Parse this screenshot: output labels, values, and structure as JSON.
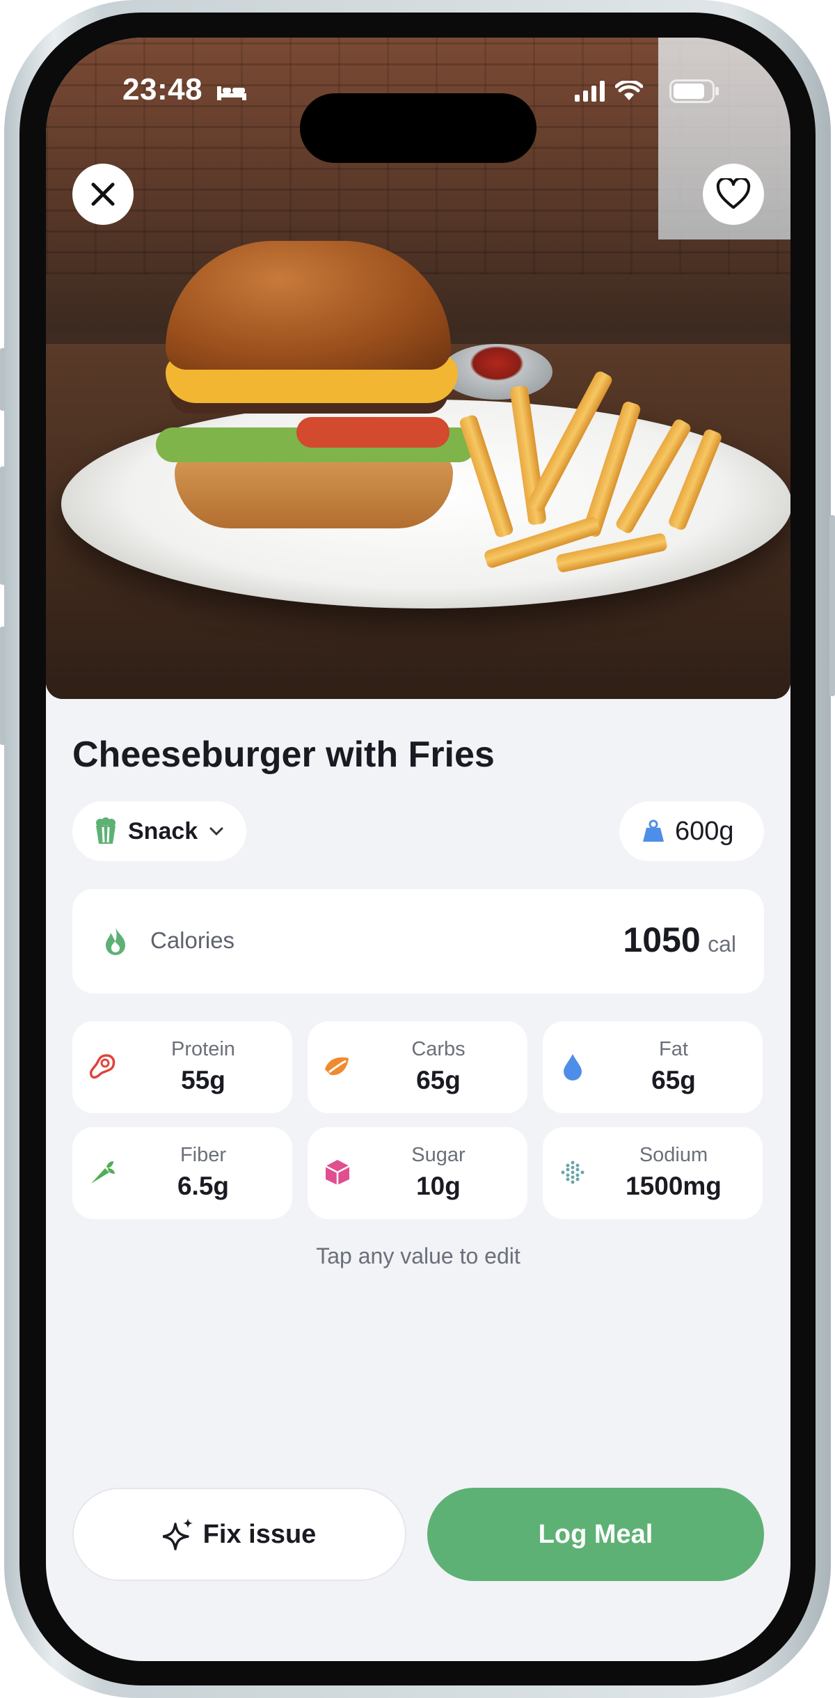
{
  "status_bar": {
    "time": "23:48"
  },
  "meal": {
    "title": "Cheeseburger with Fries",
    "meal_type": "Snack",
    "weight": "600g",
    "calories_label": "Calories",
    "calories_value": "1050",
    "calories_unit": "cal"
  },
  "nutrients": [
    {
      "label": "Protein",
      "value": "55g",
      "icon": "steak-icon",
      "color": "#e0443a"
    },
    {
      "label": "Carbs",
      "value": "65g",
      "icon": "leaf-icon",
      "color": "#ef8a2e"
    },
    {
      "label": "Fat",
      "value": "65g",
      "icon": "drop-icon",
      "color": "#4f8ee8"
    },
    {
      "label": "Fiber",
      "value": "6.5g",
      "icon": "carrot-icon",
      "color": "#4fae56"
    },
    {
      "label": "Sugar",
      "value": "10g",
      "icon": "cube-icon",
      "color": "#e04f8f"
    },
    {
      "label": "Sodium",
      "value": "1500mg",
      "icon": "salt-icon",
      "color": "#6aa5a8"
    }
  ],
  "hint": "Tap any value to edit",
  "actions": {
    "fix_label": "Fix issue",
    "log_label": "Log Meal"
  },
  "colors": {
    "accent_green": "#5db174",
    "background": "#f2f3f7",
    "text_dark": "#1a1b22",
    "text_muted": "#6b6f7a"
  }
}
